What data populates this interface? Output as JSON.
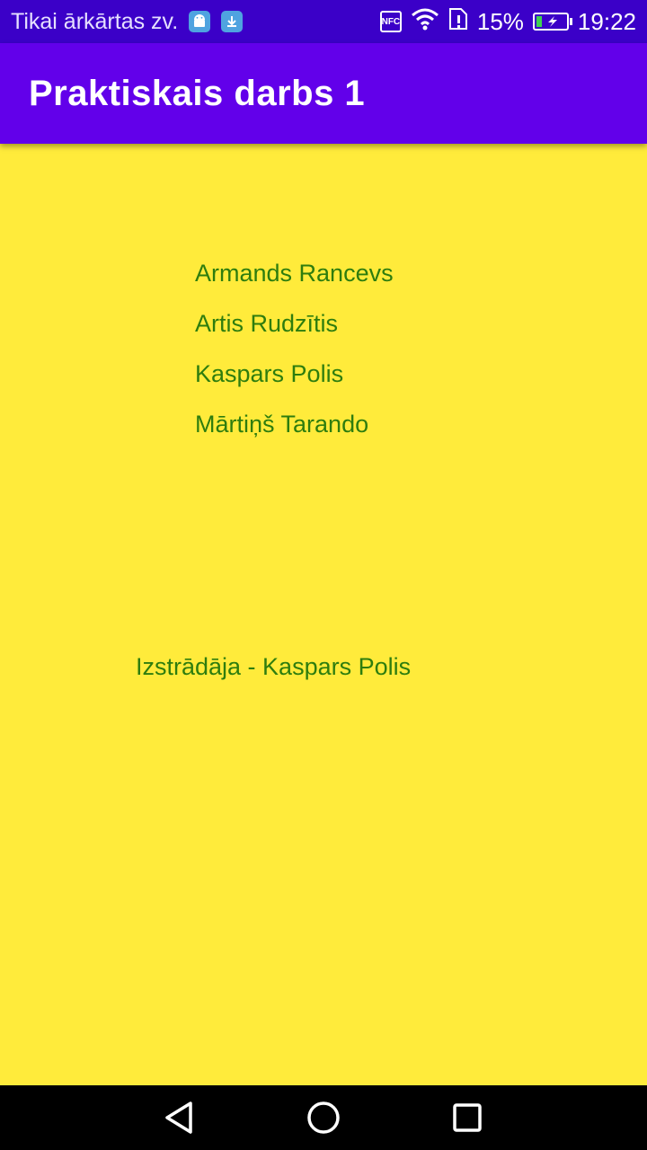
{
  "status_bar": {
    "carrier": "Tikai ārkārtas zv.",
    "nfc_label": "NFC",
    "battery_percent": "15%",
    "time": "19:22",
    "icons": [
      "android-debug-icon",
      "download-icon",
      "nfc-icon",
      "wifi-icon",
      "sim-alert-icon",
      "battery-charging-icon"
    ]
  },
  "app_bar": {
    "title": "Praktiskais darbs 1"
  },
  "names": [
    "Armands Rancevs",
    "Artis Rudzītis",
    "Kaspars Polis",
    "Mārtiņš Tarando"
  ],
  "credits": "Izstrādāja - Kaspars Polis",
  "nav_bar": {
    "icons": [
      "back-icon",
      "home-icon",
      "recent-apps-icon"
    ]
  },
  "colors": {
    "status_bar": "#3b00c8",
    "app_bar": "#6200ea",
    "background": "#ffeb3b",
    "text": "#2e7d0e"
  }
}
